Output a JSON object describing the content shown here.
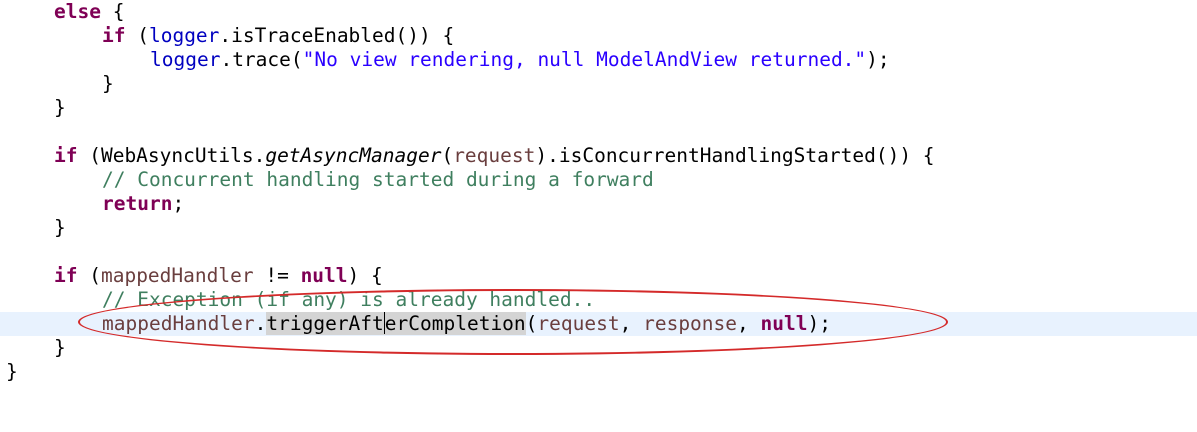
{
  "lines": {
    "l1": {
      "kw": "else",
      "rest": " {"
    },
    "l2": {
      "kw": "if",
      "pre": " (",
      "fld1": "logger",
      "post": ".isTraceEnabled()) {"
    },
    "l3": {
      "fld": "logger",
      "mid": ".trace(",
      "str": "\"No view rendering, null ModelAndView returned.\"",
      "end": ");"
    },
    "l4": {
      "text": "}"
    },
    "l5": {
      "text": "}"
    },
    "l7": {
      "kw": "if",
      "pre": " (WebAsyncUtils.",
      "ital": "getAsyncManager",
      "mid": "(",
      "var": "request",
      "post": ").isConcurrentHandlingStarted()) {"
    },
    "l8": {
      "cmt": "// Concurrent handling started during a forward"
    },
    "l9": {
      "kw": "return",
      "rest": ";"
    },
    "l10": {
      "text": "}"
    },
    "l12": {
      "kw": "if",
      "pre": " (",
      "var": "mappedHandler",
      "mid": " != ",
      "kw2": "null",
      "post": ") {"
    },
    "l13": {
      "cmt": "// Exception (if any) is already handled.."
    },
    "l14": {
      "var": "mappedHandler",
      "dot": ".",
      "occ_a": "triggerAft",
      "occ_b": "erCompletion",
      "open": "(",
      "var2": "request",
      "comma": ", ",
      "var3": "response",
      "comma2": ", ",
      "kw": "null",
      "end": ");"
    },
    "l15": {
      "text": "}"
    },
    "l16": {
      "text": "}"
    }
  },
  "colors": {
    "keyword": "#7f0055",
    "field": "#0000c0",
    "string": "#2a00ff",
    "comment": "#3f7f5f",
    "local_variable": "#6a3e3e",
    "current_line": "#e8f2fe",
    "occurrence_highlight": "#d4d4d4",
    "annotation_ellipse": "#d42a2a"
  }
}
